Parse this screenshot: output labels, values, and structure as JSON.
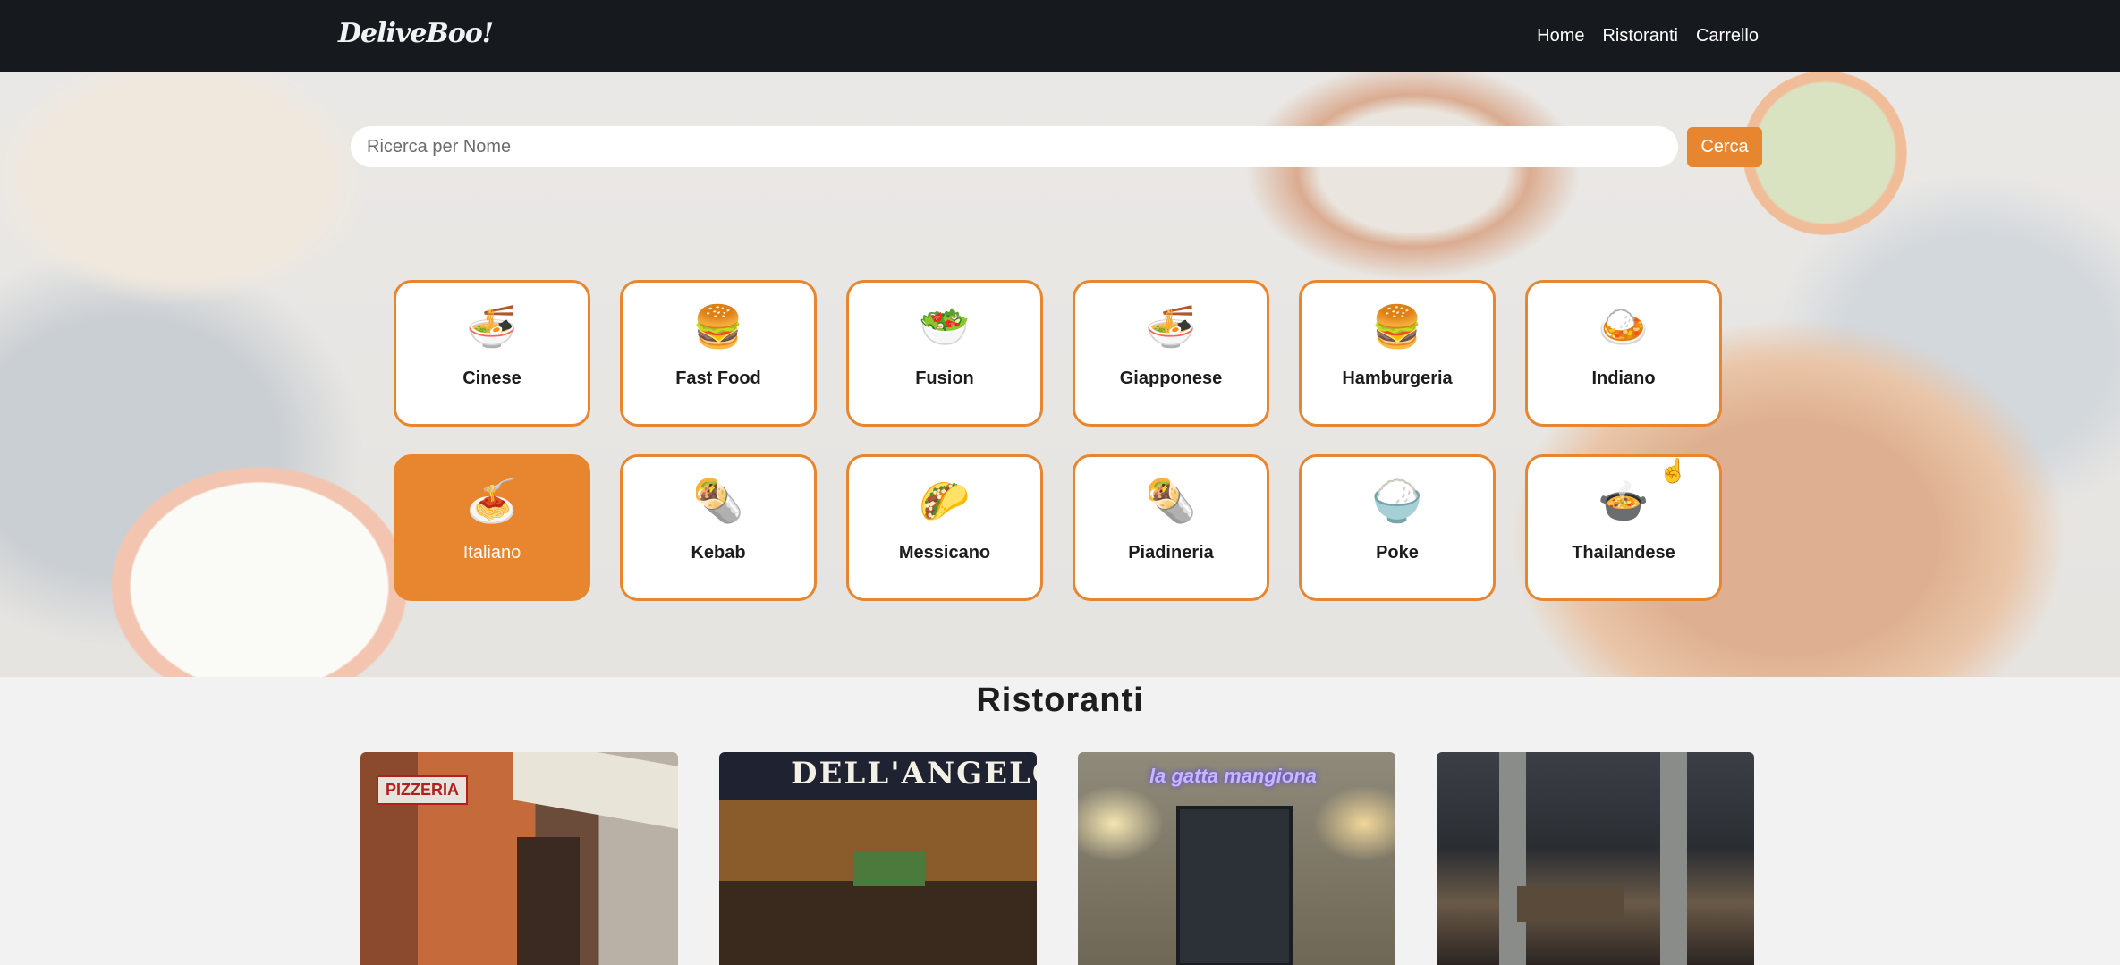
{
  "navbar": {
    "logo": "DeliveBoo!",
    "links": [
      "Home",
      "Ristoranti",
      "Carrello"
    ]
  },
  "search": {
    "placeholder": "Ricerca per Nome",
    "button_label": "Cerca"
  },
  "categories": [
    {
      "label": "Cinese",
      "icon": "noodle-bowl-icon",
      "glyph": "🍜",
      "active": false
    },
    {
      "label": "Fast Food",
      "icon": "fast-food-icon",
      "glyph": "🍔",
      "active": false
    },
    {
      "label": "Fusion",
      "icon": "fusion-plate-icon",
      "glyph": "🥗",
      "active": false
    },
    {
      "label": "Giapponese",
      "icon": "ramen-icon",
      "glyph": "🍜",
      "active": false
    },
    {
      "label": "Hamburgeria",
      "icon": "hamburger-icon",
      "glyph": "🍔",
      "active": false
    },
    {
      "label": "Indiano",
      "icon": "indian-food-icon",
      "glyph": "🍛",
      "active": false
    },
    {
      "label": "Italiano",
      "icon": "spaghetti-icon",
      "glyph": "🍝",
      "active": true
    },
    {
      "label": "Kebab",
      "icon": "kebab-wrap-icon",
      "glyph": "🌯",
      "active": false
    },
    {
      "label": "Messicano",
      "icon": "taco-icon",
      "glyph": "🌮",
      "active": false
    },
    {
      "label": "Piadineria",
      "icon": "piadina-icon",
      "glyph": "🌯",
      "active": false
    },
    {
      "label": "Poke",
      "icon": "poke-bowl-icon",
      "glyph": "🍚",
      "active": false
    },
    {
      "label": "Thailandese",
      "icon": "thai-curry-icon",
      "glyph": "🍲",
      "active": false
    }
  ],
  "restaurants_section": {
    "title": "Ristoranti",
    "cards": [
      {
        "sign": "PIZZERIA"
      },
      {
        "sign": "DELL'ANGELO"
      },
      {
        "sign": "la gatta mangiona"
      },
      {
        "sign": ""
      }
    ]
  },
  "colors": {
    "accent": "#e8862f",
    "navbar": "#16191e",
    "background": "#f2f2f2"
  }
}
